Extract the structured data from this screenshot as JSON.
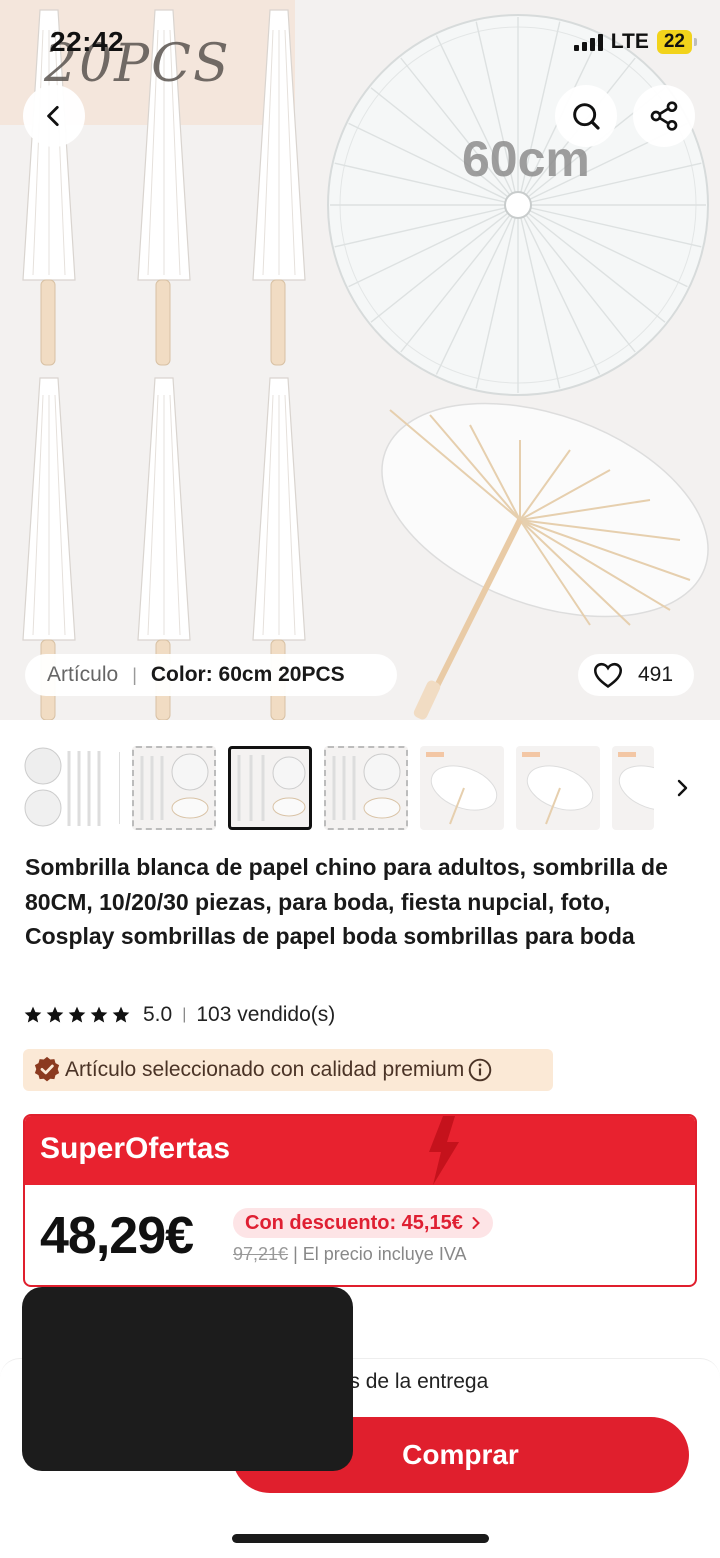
{
  "status_bar": {
    "time": "22:42",
    "network": "LTE",
    "battery": "22"
  },
  "hero": {
    "overlay_text_top": "20PCS",
    "overlay_text_size": "60cm",
    "article_label": "Artículo",
    "color_value": "Color: 60cm 20PCS",
    "likes": "491"
  },
  "product": {
    "title": "Sombrilla blanca de papel chino para adultos, sombrilla de 80CM, 10/20/30 piezas, para boda, fiesta nupcial, foto, Cosplay sombrillas de papel boda sombrillas para boda",
    "rating": "5.0",
    "sold": "103 vendido(s)",
    "premium_badge": "Artículo seleccionado con calidad premium"
  },
  "deal": {
    "title": "SuperOfertas",
    "price": "48,29€",
    "discount": "Con descuento: 45,15€",
    "old_price": "97,21€",
    "tax_note": "| El precio incluye IVA"
  },
  "bottom": {
    "delivery_text": "ués de la entrega",
    "buy_label": "Comprar"
  },
  "colors": {
    "accent": "#e01f2d",
    "premium_bg": "#fbe9d6",
    "battery": "#f2d31b"
  },
  "icons": [
    "back-icon",
    "search-icon",
    "share-icon",
    "heart-icon",
    "star-icon",
    "premium-icon",
    "info-icon",
    "chevron-right-icon",
    "lightning-icon"
  ]
}
